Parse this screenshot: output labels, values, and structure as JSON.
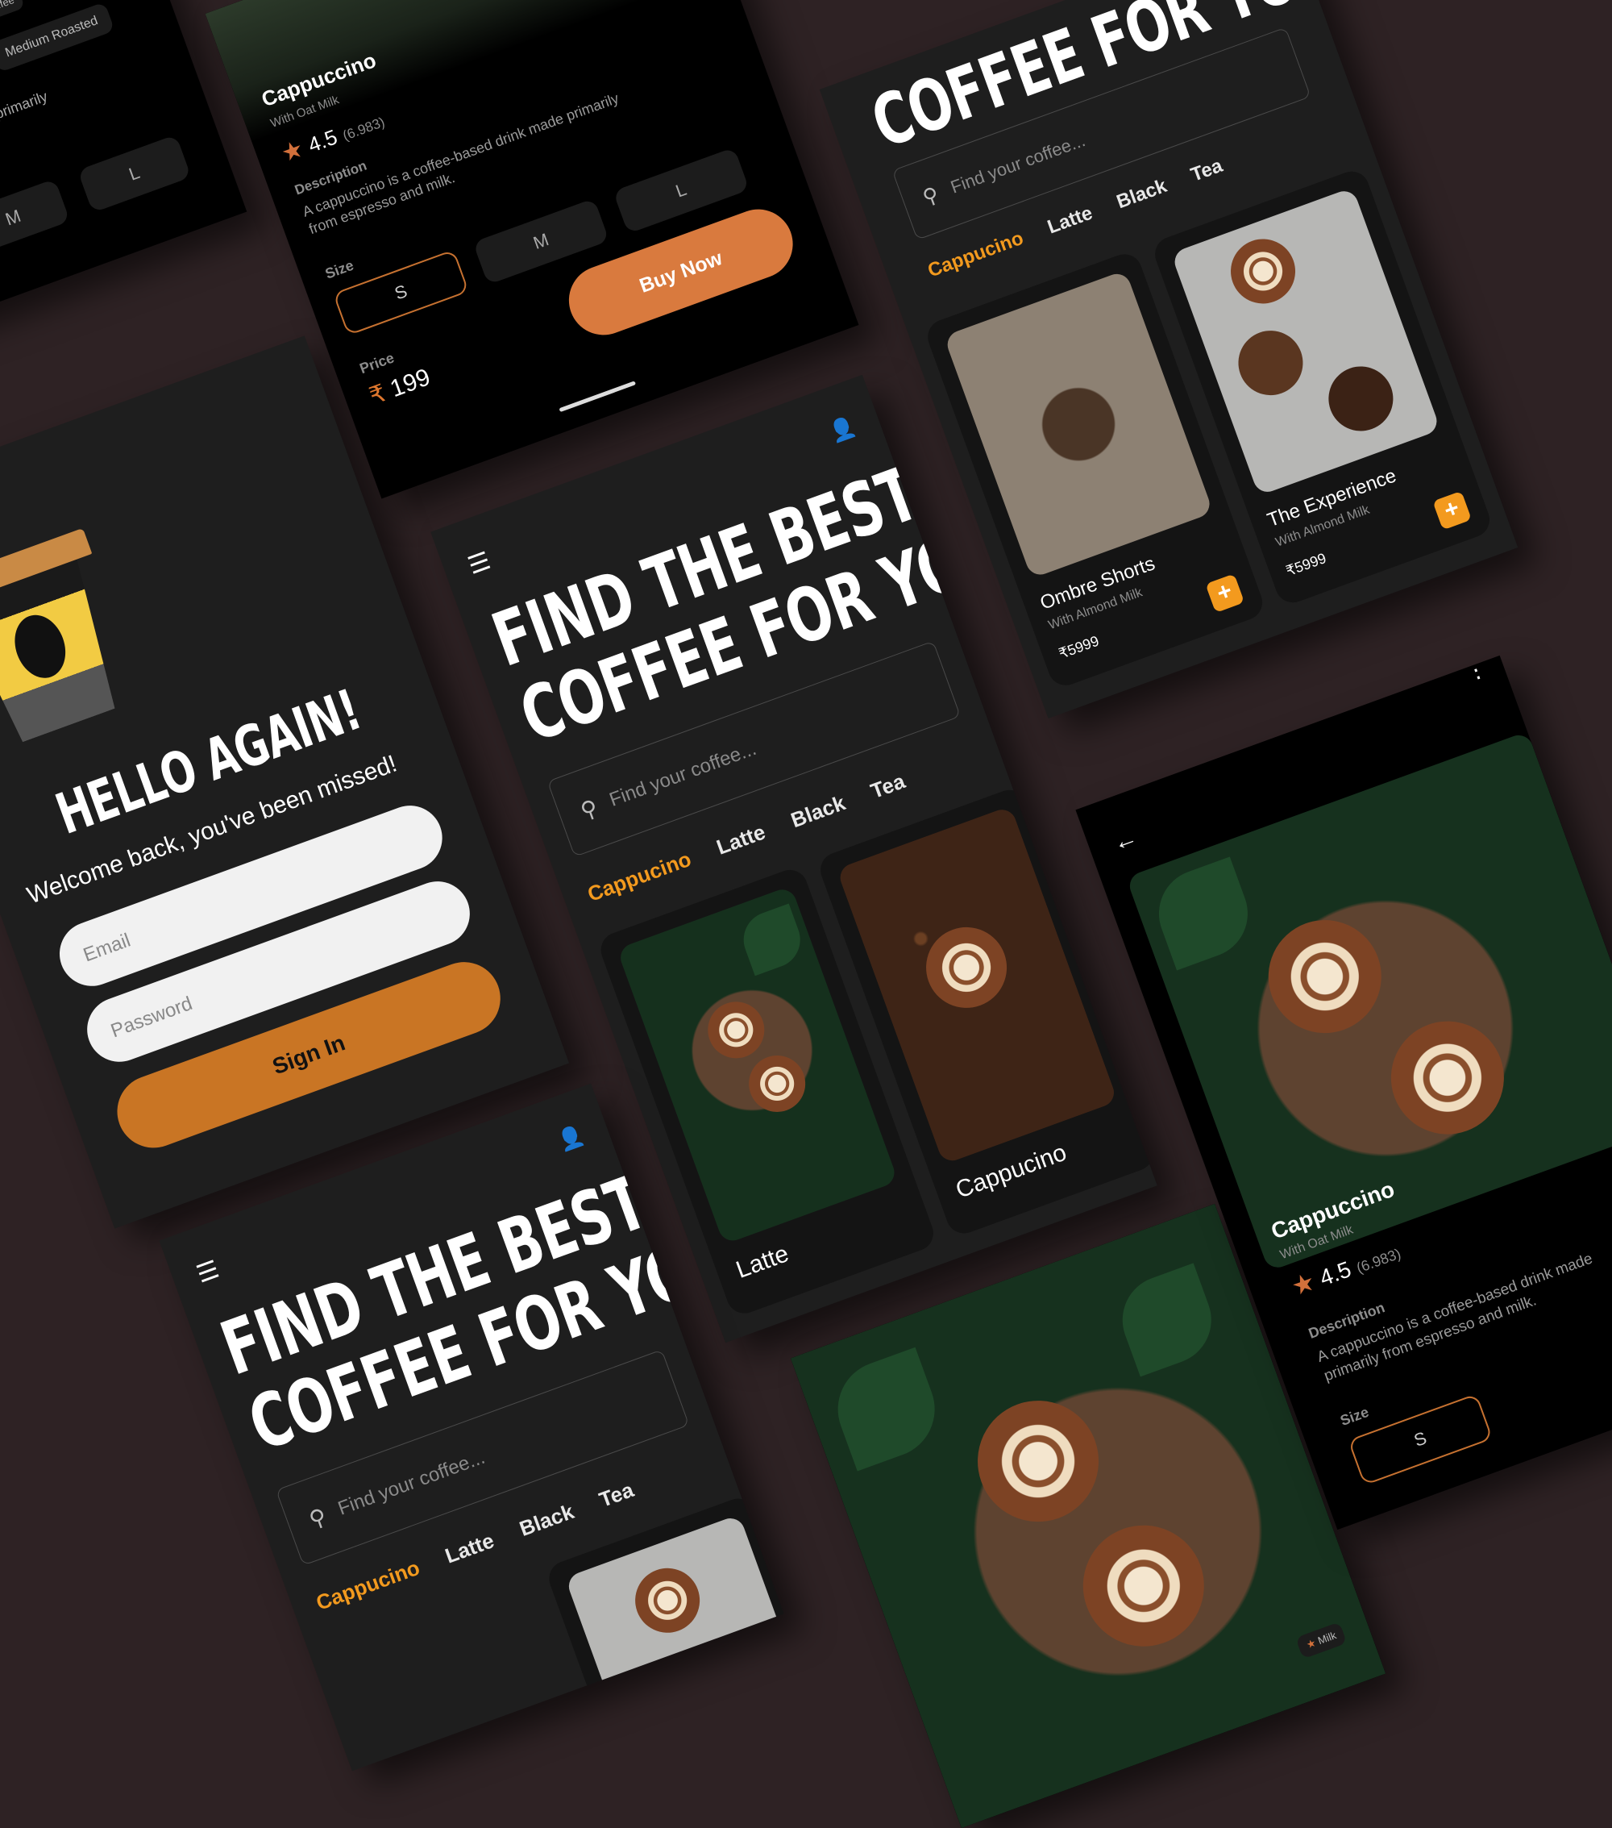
{
  "brand": {
    "accent": "#f39a1e",
    "button": "#c97524",
    "buy": "#d97a3e",
    "background": "#2e2224"
  },
  "login": {
    "title": "HELLO AGAIN!",
    "subtitle": "Welcome back, you've been missed!",
    "email_placeholder": "Email",
    "password_placeholder": "Password",
    "signin_label": "Sign In"
  },
  "home": {
    "headline_line1": "FIND THE BEST",
    "headline_line2": "COFFEE FOR YOU",
    "search_placeholder": "Find your coffee...",
    "tabs": [
      "Cappucino",
      "Latte",
      "Black",
      "Tea"
    ],
    "cards": [
      {
        "title": "Latte"
      },
      {
        "title": "Cappucino"
      }
    ]
  },
  "products": {
    "items": [
      {
        "title": "Ombre Shorts",
        "subtitle": "With Almond Milk",
        "price": "₹5999"
      },
      {
        "title": "The Experience",
        "subtitle": "With Almond Milk",
        "price": "₹5999"
      }
    ]
  },
  "detail": {
    "name": "Cappuccino",
    "variant": "With Oat Milk",
    "rating": "4.5",
    "reviews": "(6.983)",
    "description_label": "Description",
    "description": "A cappuccino is a coffee-based drink made primarily from espresso and milk.",
    "size_label": "Size",
    "sizes": [
      "S",
      "M",
      "L"
    ],
    "price_label": "Price",
    "price_currency": "₹",
    "price_value": "199",
    "buy_label": "Buy Now",
    "chips": [
      "Coffee",
      "Medium Roasted",
      "Milk"
    ]
  }
}
